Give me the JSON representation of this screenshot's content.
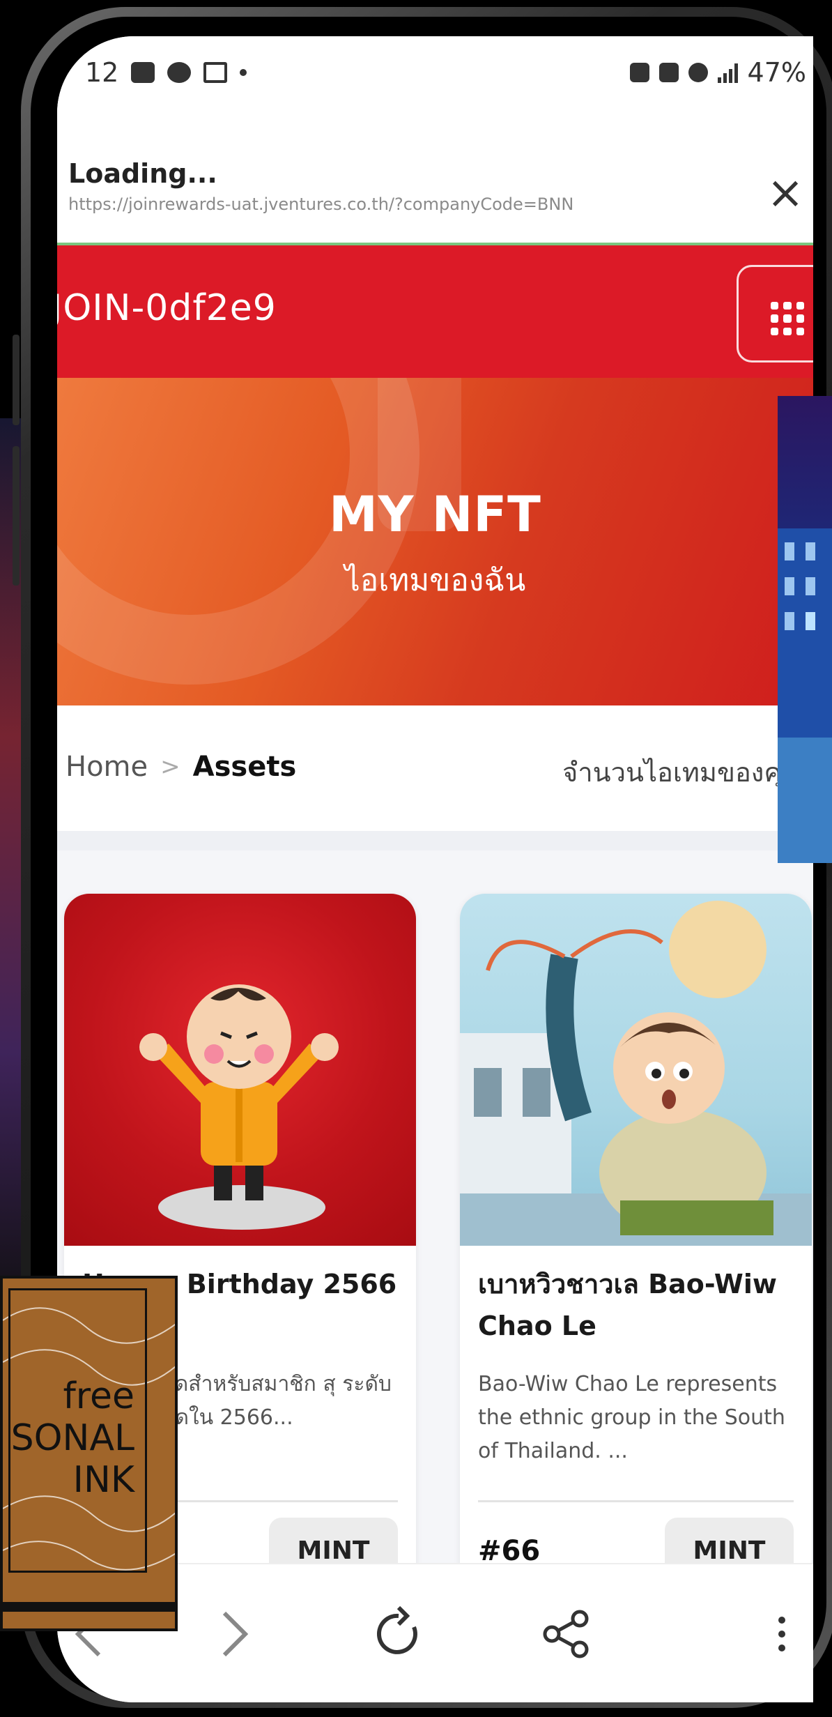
{
  "status_bar": {
    "time": "12",
    "battery": "47%"
  },
  "browser": {
    "loading_title": "Loading...",
    "url": "https://joinrewards-uat.jventures.co.th/?companyCode=BNN",
    "close_label": "×"
  },
  "header": {
    "account_id": "JOIN-0df2e9"
  },
  "hero": {
    "title": "MY NFT",
    "subtitle": "ไอเทมของฉัน"
  },
  "breadcrumb": {
    "home": "Home",
    "current": "Assets",
    "item_count_label": "จำนวนไอเทมของคุณ"
  },
  "cards": [
    {
      "title": "Happy Birthday 2566 - Baby",
      "description": "NFT วันเกิดสำหรับสมาชิก สุ ระดับ Baby ที่เกิดใน 2566...",
      "number": "",
      "mint_label": "MINT"
    },
    {
      "title": "เบาหวิวชาวเล Bao-Wiw Chao Le",
      "description": "Bao-Wiw Chao Le represents the ethnic group in the South of Thailand. ...",
      "number": "#66",
      "mint_label": "MINT"
    }
  ],
  "overlay_badge": {
    "line1": "free",
    "line2": "SONAL",
    "line3": "INK"
  },
  "colors": {
    "brand_red": "#dc1a27",
    "loading_bar": "#7bc67e"
  }
}
